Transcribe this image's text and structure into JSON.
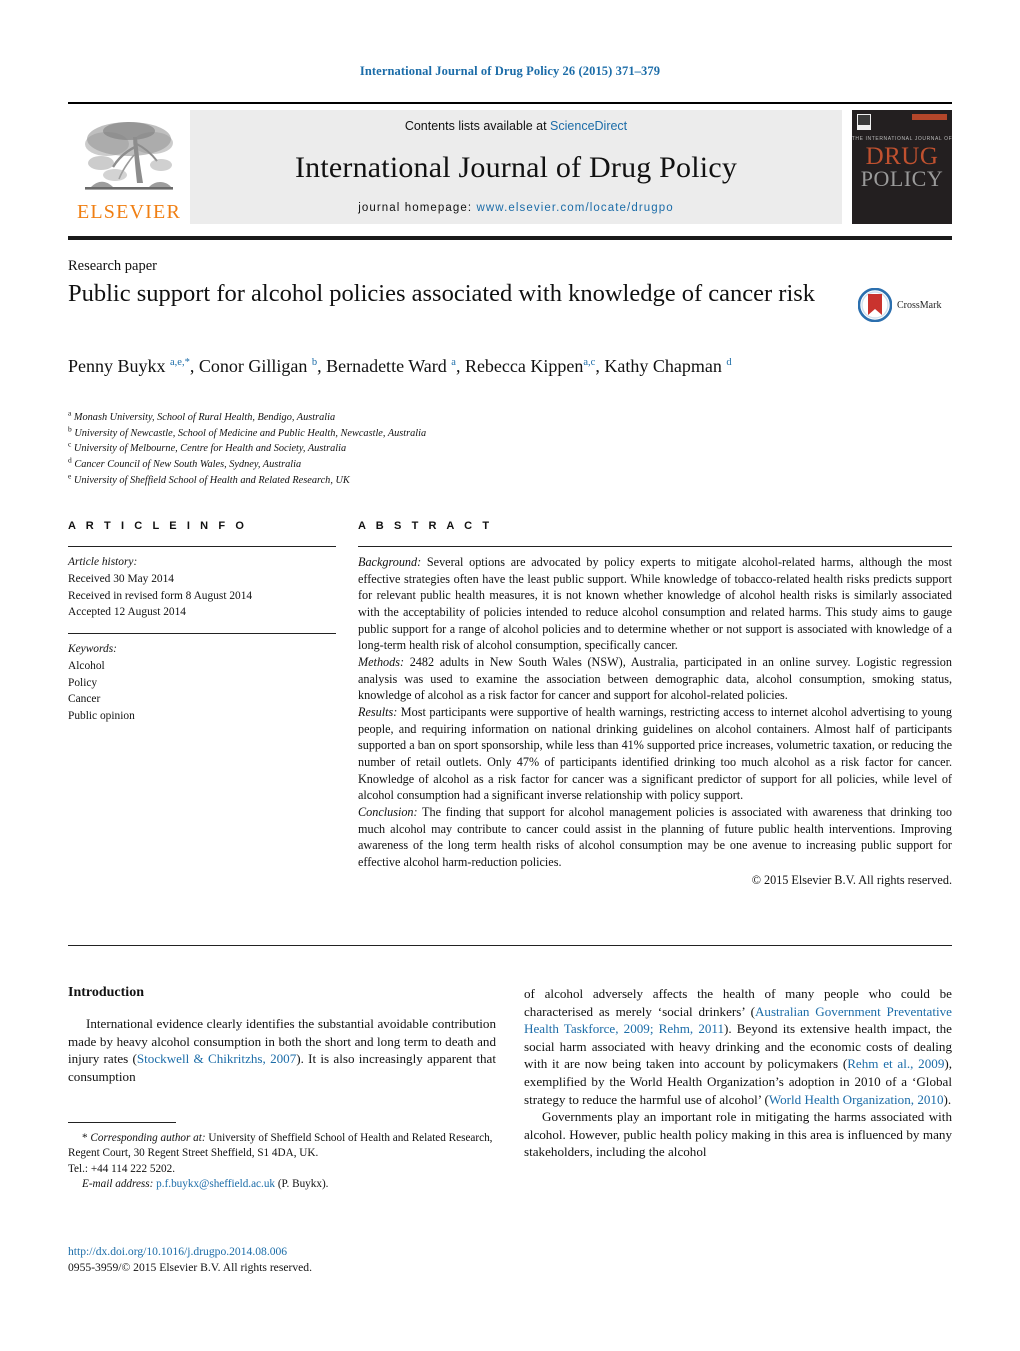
{
  "running_head": "International Journal of Drug Policy 26 (2015) 371–379",
  "masthead": {
    "publisher_wordmark": "ELSEVIER",
    "publisher_logo_name": "elsevier-tree-logo",
    "contents_prefix": "Contents lists available at ",
    "contents_link": "ScienceDirect",
    "journal_name": "International Journal of Drug Policy",
    "homepage_prefix": "journal homepage: ",
    "homepage_url": "www.elsevier.com/locate/drugpo",
    "cover_title_small": "THE INTERNATIONAL JOURNAL OF",
    "cover_title_line1": "DRUG",
    "cover_title_line2": "POLICY"
  },
  "article": {
    "type": "Research paper",
    "title": "Public support for alcohol policies associated with knowledge of cancer risk",
    "crossmark_label": "CrossMark",
    "authors_html": "Penny Buykx <sup>a,e,*</sup>, Conor Gilligan <sup>b</sup>, Bernadette Ward <sup>a</sup>, Rebecca Kippen<sup>a,c</sup>, Kathy Chapman <sup>d</sup>",
    "affiliations": [
      {
        "marker": "a",
        "text": "Monash University, School of Rural Health, Bendigo, Australia"
      },
      {
        "marker": "b",
        "text": "University of Newcastle, School of Medicine and Public Health, Newcastle, Australia"
      },
      {
        "marker": "c",
        "text": "University of Melbourne, Centre for Health and Society, Australia"
      },
      {
        "marker": "d",
        "text": "Cancer Council of New South Wales, Sydney, Australia"
      },
      {
        "marker": "e",
        "text": "University of Sheffield School of Health and Related Research, UK"
      }
    ]
  },
  "article_info": {
    "heading": "A R T I C L E    I N F O",
    "history_label": "Article history:",
    "history": [
      "Received 30 May 2014",
      "Received in revised form 8 August 2014",
      "Accepted 12 August 2014"
    ],
    "keywords_label": "Keywords:",
    "keywords": [
      "Alcohol",
      "Policy",
      "Cancer",
      "Public opinion"
    ]
  },
  "abstract": {
    "heading": "A B S T R A C T",
    "background_label": "Background:",
    "background": " Several options are advocated by policy experts to mitigate alcohol-related harms, although the most effective strategies often have the least public support. While knowledge of tobacco-related health risks predicts support for relevant public health measures, it is not known whether knowledge of alcohol health risks is similarly associated with the acceptability of policies intended to reduce alcohol consumption and related harms. This study aims to gauge public support for a range of alcohol policies and to determine whether or not support is associated with knowledge of a long-term health risk of alcohol consumption, specifically cancer.",
    "methods_label": "Methods:",
    "methods": " 2482 adults in New South Wales (NSW), Australia, participated in an online survey. Logistic regression analysis was used to examine the association between demographic data, alcohol consumption, smoking status, knowledge of alcohol as a risk factor for cancer and support for alcohol-related policies.",
    "results_label": "Results:",
    "results": " Most participants were supportive of health warnings, restricting access to internet alcohol advertising to young people, and requiring information on national drinking guidelines on alcohol containers. Almost half of participants supported a ban on sport sponsorship, while less than 41% supported price increases, volumetric taxation, or reducing the number of retail outlets. Only 47% of participants identified drinking too much alcohol as a risk factor for cancer. Knowledge of alcohol as a risk factor for cancer was a significant predictor of support for all policies, while level of alcohol consumption had a significant inverse relationship with policy support.",
    "conclusion_label": "Conclusion:",
    "conclusion": " The finding that support for alcohol management policies is associated with awareness that drinking too much alcohol may contribute to cancer could assist in the planning of future public health interventions. Improving awareness of the long term health risks of alcohol consumption may be one avenue to increasing public support for effective alcohol harm-reduction policies.",
    "copyright": "© 2015 Elsevier B.V. All rights reserved."
  },
  "introduction": {
    "heading": "Introduction",
    "left_para1_a": "International evidence clearly identifies the substantial avoidable contribution made by heavy alcohol consumption in both the short and long term to death and injury rates (",
    "left_ref1": "Stockwell & Chikritzhs, 2007",
    "left_para1_b": "). It is also increasingly apparent that consumption",
    "right_para1_a": "of alcohol adversely affects the health of many people who could be characterised as merely ‘social drinkers’ (",
    "right_ref1": "Australian Government Preventative Health Taskforce, 2009; Rehm, 2011",
    "right_para1_b": "). Beyond its extensive health impact, the social harm associated with heavy drinking and the economic costs of dealing with it are now being taken into account by policymakers (",
    "right_ref2": "Rehm et al., 2009",
    "right_para1_c": "), exemplified by the World Health Organization’s adoption in 2010 of a ‘Global strategy to reduce the harmful use of alcohol’ (",
    "right_ref3": "World Health Organization, 2010",
    "right_para1_d": ").",
    "right_para2": "Governments play an important role in mitigating the harms associated with alcohol. However, public health policy making in this area is influenced by many stakeholders, including the alcohol"
  },
  "footnote": {
    "corresponding_marker": "*",
    "corresponding_label": " Corresponding author at: ",
    "corresponding_text": "University of Sheffield School of Health and Related Research, Regent Court, 30 Regent Street Sheffield, S1 4DA, UK.",
    "tel": "Tel.: +44 114 222 5202.",
    "email_label": "E-mail address:",
    "email": "p.f.buykx@sheffield.ac.uk",
    "email_owner": "(P. Buykx)."
  },
  "doi_block": {
    "doi_url": "http://dx.doi.org/10.1016/j.drugpo.2014.08.006",
    "issn_line": "0955-3959/© 2015 Elsevier B.V. All rights reserved."
  },
  "colors": {
    "link_blue": "#1b6ca8",
    "elsevier_orange": "#f07f13",
    "masthead_grey": "#ececec",
    "cover_dark": "#231f20",
    "crossmark_red": "#c9332e",
    "crossmark_blue": "#2b6fae"
  }
}
